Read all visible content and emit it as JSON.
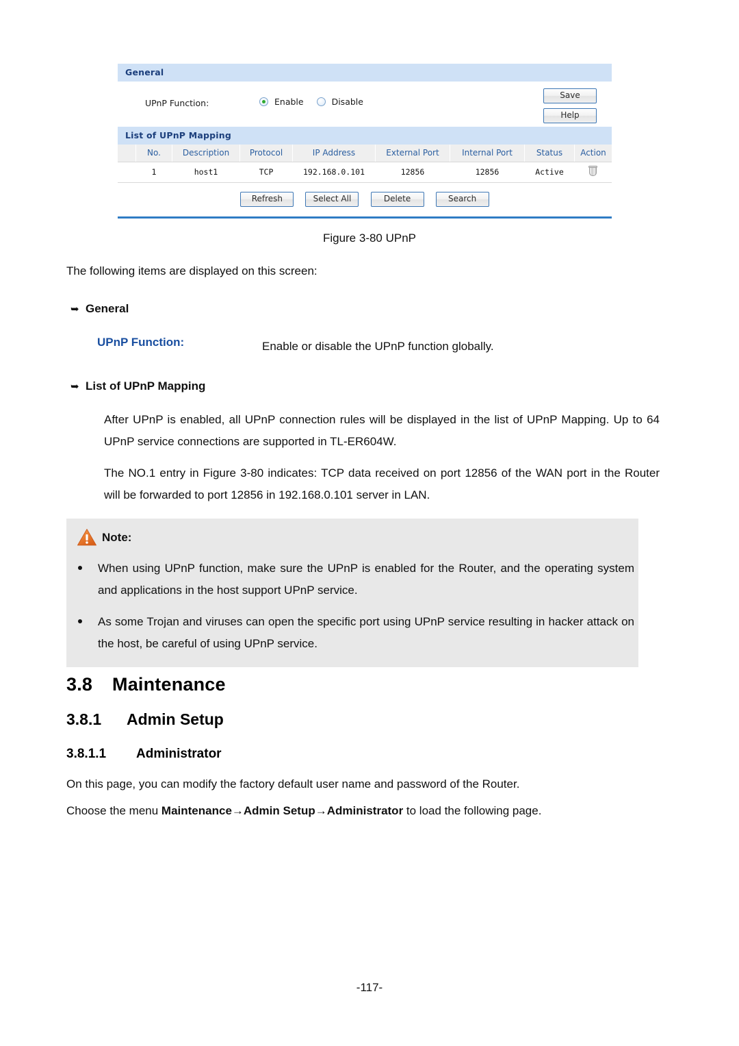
{
  "screenshot": {
    "general_section_title": "General",
    "upnp_function_label": "UPnP Function:",
    "radio_enable_label": "Enable",
    "radio_disable_label": "Disable",
    "radio_selected": "Enable",
    "save_button": "Save",
    "help_button": "Help",
    "list_section_title": "List of UPnP Mapping",
    "table": {
      "headers": [
        "No.",
        "Description",
        "Protocol",
        "IP Address",
        "External Port",
        "Internal Port",
        "Status",
        "Action"
      ],
      "rows": [
        {
          "no": "1",
          "description": "host1",
          "protocol": "TCP",
          "ip_address": "192.168.0.101",
          "external_port": "12856",
          "internal_port": "12856",
          "status": "Active",
          "action_icon": "trash-icon"
        }
      ]
    },
    "buttons": [
      "Refresh",
      "Select All",
      "Delete",
      "Search"
    ],
    "colors": {
      "section_bar_bg": "#cfe1f6",
      "section_bar_text": "#1c3f7c",
      "table_header_text": "#2a5ea0",
      "button_border": "#3c76b4",
      "radio_dot": "#2faa2f",
      "panel_bottom_rule": "#2f7cc4"
    }
  },
  "document": {
    "figure_caption": "Figure 3-80 UPnP",
    "intro": "The following items are displayed on this screen:",
    "bullet_general": "General",
    "term_upnp_function": "UPnP Function:",
    "term_upnp_function_desc": "Enable or disable the UPnP function globally.",
    "bullet_list_mapping": "List of UPnP Mapping",
    "para_1": "After UPnP is enabled, all UPnP connection rules will be displayed in the list of UPnP Mapping. Up to 64 UPnP service connections are supported in TL-ER604W.",
    "para_2": "The NO.1 entry in Figure 3-80 indicates: TCP data received on port 12856 of the WAN port in the Router will be forwarded to port 12856 in 192.168.0.101 server in LAN.",
    "note": {
      "title": "Note:",
      "icon": "warning-triangle-icon",
      "items": [
        "When using UPnP function, make sure the UPnP is enabled for the Router, and the operating system and applications in the host support UPnP service.",
        "As some Trojan and viruses can open the specific port using UPnP service resulting in hacker attack on the host, be careful of using UPnP service."
      ],
      "bg_color": "#e8e8e8",
      "icon_color": "#e8782c"
    },
    "heading_38_number": "3.8",
    "heading_38_title": "Maintenance",
    "heading_381_number": "3.8.1",
    "heading_381_title": "Admin Setup",
    "heading_3811_number": "3.8.1.1",
    "heading_3811_title": "Administrator",
    "para_3": "On this page, you can modify the factory default user name and password of the Router.",
    "para_4_prefix": "Choose the menu ",
    "para_4_menu": "Maintenance→Admin Setup→Administrator",
    "para_4_suffix": " to load the following page.",
    "page_number": "-117-",
    "term_blue_color": "#1a4fa0"
  }
}
